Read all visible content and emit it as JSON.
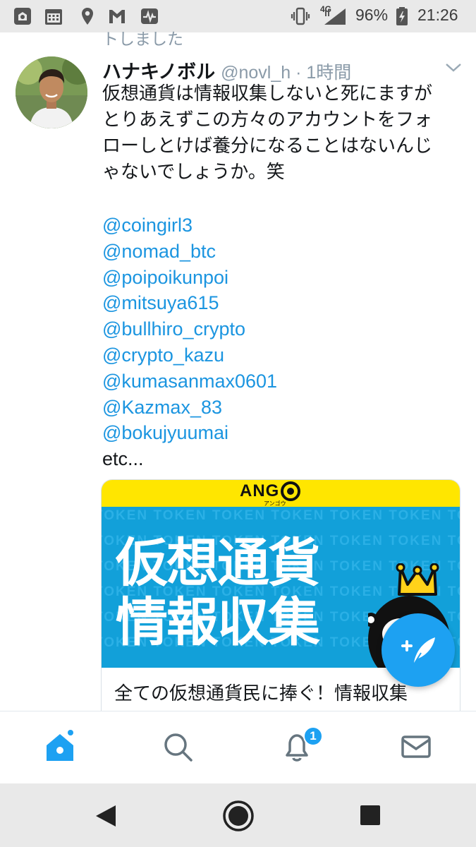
{
  "status_bar": {
    "network": "4G",
    "battery": "96%",
    "time": "21:26",
    "icons": [
      "app-icon",
      "calendar-icon",
      "location-icon",
      "gmail-icon",
      "activity-icon",
      "vibrate-icon",
      "signal-icon",
      "battery-icon"
    ]
  },
  "timeline": {
    "retweet_hint": "トしました"
  },
  "tweet": {
    "display_name": "ハナキノボル",
    "handle_time": "@novl_h · 1時間",
    "text_lines": [
      "仮想通貨は情報収集しないと死にますが",
      "とりあえずこの方々のアカウントをフォ",
      "ローしとけば養分になることはないんじ",
      "ゃないでしょうか。笑"
    ],
    "mentions": [
      "@coingirl3",
      "@nomad_btc",
      "@poipoikunpoi",
      "@mitsuya615",
      "@bullhiro_crypto",
      "@crypto_kazu",
      "@kumasanmax0601",
      "@Kazmax_83",
      "@bokujyuumai"
    ],
    "trailing": "etc...",
    "card": {
      "logo": "ANG",
      "logo_sub": "アンゴウ",
      "watermark": "TOKEN",
      "headline_line1": "仮想通貨",
      "headline_line2": "情報収集",
      "title": "全ての仮想通貨民に捧ぐ！情報収集"
    }
  },
  "tabbar": {
    "tabs": [
      "home",
      "search",
      "notifications",
      "messages"
    ],
    "notification_count": "1"
  },
  "colors": {
    "accent": "#1da1f2",
    "link": "#1b95e0",
    "muted": "#8a9aa8",
    "card_yellow": "#ffe600",
    "card_blue": "#12a0d9"
  }
}
